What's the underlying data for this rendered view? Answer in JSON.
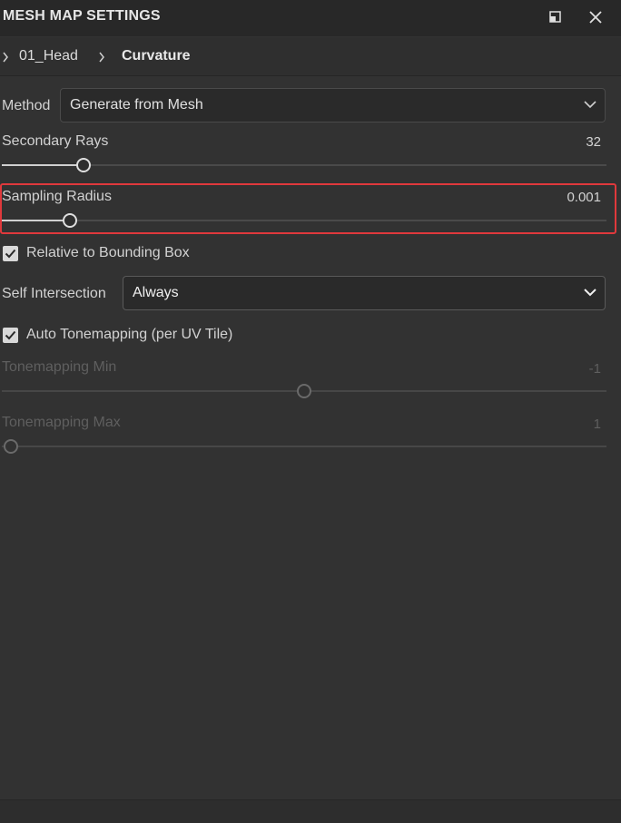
{
  "panel": {
    "title": "MESH MAP SETTINGS"
  },
  "window_controls": {
    "restore_icon": "restore-icon",
    "close_icon": "close-icon"
  },
  "breadcrumb": {
    "items": [
      "01_Head",
      "Curvature"
    ]
  },
  "method": {
    "label": "Method",
    "value": "Generate from Mesh"
  },
  "secondary_rays": {
    "label": "Secondary Rays",
    "value": "32",
    "fraction": 0.135
  },
  "sampling_radius": {
    "label": "Sampling Radius",
    "value": "0.001",
    "fraction": 0.113
  },
  "relative_bbox": {
    "label": "Relative to Bounding Box",
    "checked": true
  },
  "self_intersection": {
    "label": "Self Intersection",
    "value": "Always"
  },
  "auto_tonemapping": {
    "label": "Auto Tonemapping (per UV Tile)",
    "checked": true
  },
  "tonemapping_min": {
    "label": "Tonemapping Min",
    "value": "-1",
    "fraction": 0.5,
    "enabled": false
  },
  "tonemapping_max": {
    "label": "Tonemapping Max",
    "value": "1",
    "fraction": 0.0,
    "enabled": false
  },
  "colors": {
    "background": "#323232",
    "header": "#282828",
    "highlight": "#e0393c"
  }
}
